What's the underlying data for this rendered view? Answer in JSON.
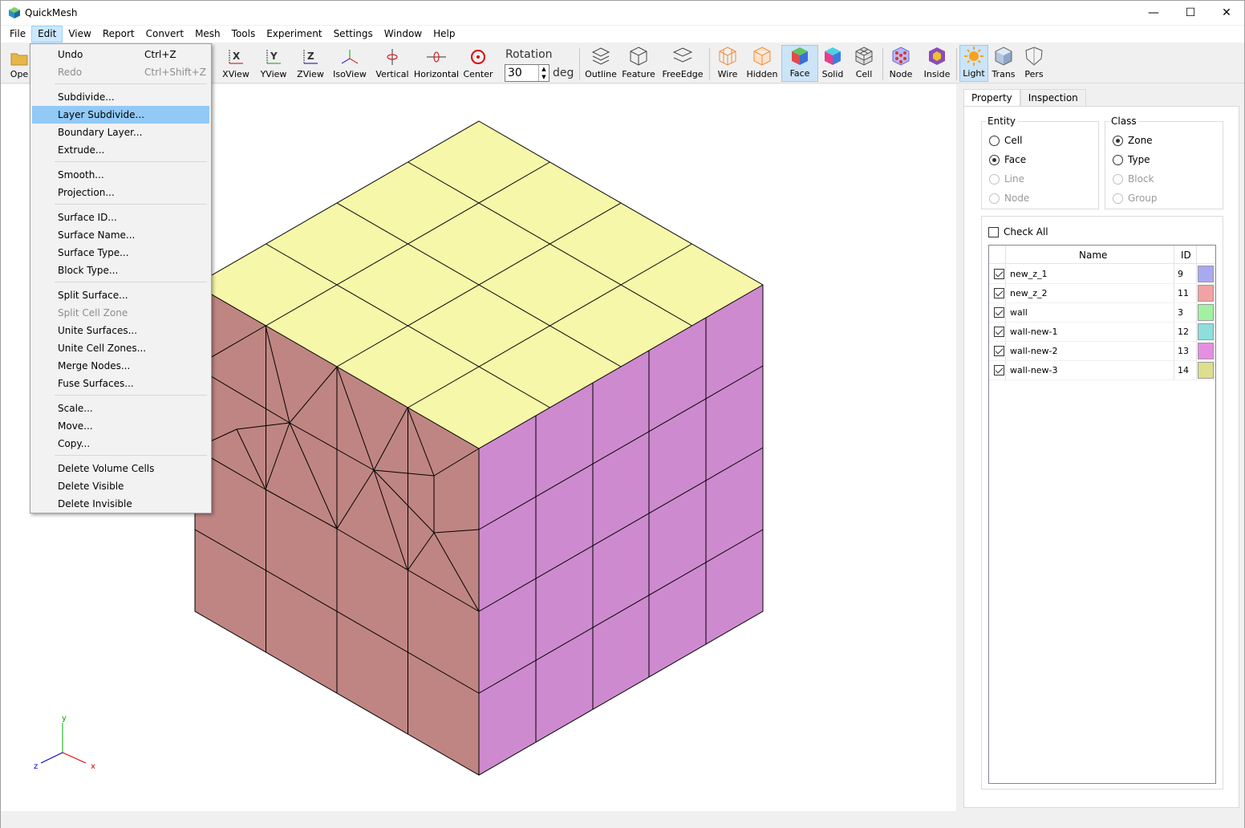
{
  "app": {
    "title": "QuickMesh"
  },
  "window_controls": {
    "minimize": "—",
    "maximize": "☐",
    "close": "✕"
  },
  "menubar": [
    "File",
    "Edit",
    "View",
    "Report",
    "Convert",
    "Mesh",
    "Tools",
    "Experiment",
    "Settings",
    "Window",
    "Help"
  ],
  "toolbar": {
    "open_label": "Ope",
    "buttons": [
      "XView",
      "YView",
      "ZView",
      "IsoView",
      "Vertical",
      "Horizontal",
      "Center",
      "Outline",
      "Feature",
      "FreeEdge",
      "Wire",
      "Hidden",
      "Face",
      "Solid",
      "Cell",
      "Node",
      "Inside",
      "Light",
      "Trans",
      "Pers"
    ],
    "rotation_label": "Rotation",
    "rotation_value": "30",
    "rotation_unit": "deg"
  },
  "edit_menu": {
    "items": [
      {
        "label": "Undo",
        "shortcut": "Ctrl+Z"
      },
      {
        "label": "Redo",
        "shortcut": "Ctrl+Shift+Z"
      },
      {
        "label": "Subdivide..."
      },
      {
        "label": "Layer Subdivide..."
      },
      {
        "label": "Boundary Layer..."
      },
      {
        "label": "Extrude..."
      },
      {
        "label": "Smooth..."
      },
      {
        "label": "Projection..."
      },
      {
        "label": "Surface ID..."
      },
      {
        "label": "Surface Name..."
      },
      {
        "label": "Surface Type..."
      },
      {
        "label": "Block Type..."
      },
      {
        "label": "Split Surface..."
      },
      {
        "label": "Split Cell Zone"
      },
      {
        "label": "Unite Surfaces..."
      },
      {
        "label": "Unite Cell Zones..."
      },
      {
        "label": "Merge Nodes..."
      },
      {
        "label": "Fuse Surfaces..."
      },
      {
        "label": "Scale..."
      },
      {
        "label": "Move..."
      },
      {
        "label": "Copy..."
      },
      {
        "label": "Delete Volume Cells"
      },
      {
        "label": "Delete Visible"
      },
      {
        "label": "Delete Invisible"
      }
    ]
  },
  "panel": {
    "tabs": [
      "Property",
      "Inspection"
    ],
    "entity": {
      "title": "Entity",
      "options": [
        "Cell",
        "Face",
        "Line",
        "Node"
      ],
      "selected": "Face"
    },
    "class": {
      "title": "Class",
      "options": [
        "Zone",
        "Type",
        "Block",
        "Group"
      ],
      "selected": "Zone"
    },
    "check_all": "Check All",
    "table": {
      "headers": [
        "Name",
        "ID"
      ],
      "rows": [
        {
          "name": "new_z_1",
          "id": "9",
          "color": "#a9a9f2"
        },
        {
          "name": "new_z_2",
          "id": "11",
          "color": "#f2a2a2"
        },
        {
          "name": "wall",
          "id": "3",
          "color": "#a2f0a2"
        },
        {
          "name": "wall-new-1",
          "id": "12",
          "color": "#8edede"
        },
        {
          "name": "wall-new-2",
          "id": "13",
          "color": "#e48ee4"
        },
        {
          "name": "wall-new-3",
          "id": "14",
          "color": "#dede8e"
        }
      ]
    }
  },
  "axes": {
    "x": "x",
    "y": "y",
    "z": "z"
  },
  "colors": {
    "top": "#f7f7aa",
    "left": "#bf8582",
    "right": "#ce8acf",
    "accent": "#91c9f7"
  }
}
